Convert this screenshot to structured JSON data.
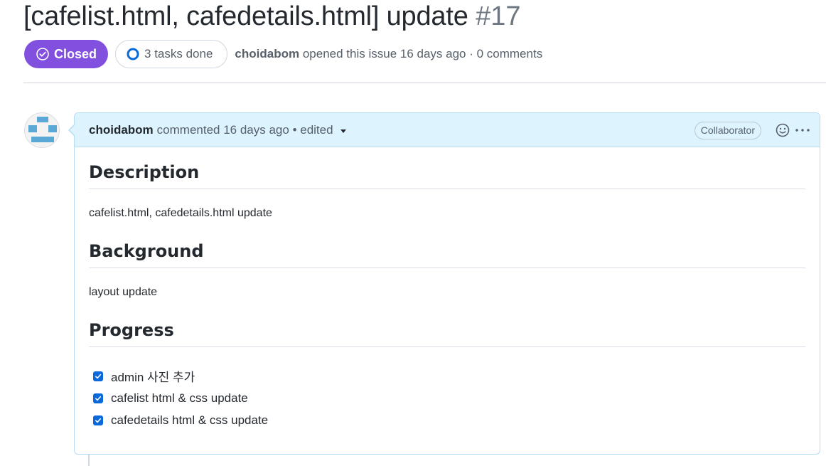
{
  "issue": {
    "title": "[cafelist.html, cafedetails.html] update",
    "number": "#17",
    "state": "Closed",
    "state_color": "#8250df",
    "tasks_summary": "3 tasks done",
    "author": "choidabom",
    "opened_text": "opened this issue 16 days ago · 0 comments"
  },
  "comment": {
    "author": "choidabom",
    "action_text": "commented 16 days ago • edited",
    "role_badge": "Collaborator",
    "header_bg": "#ddf4ff",
    "icons": [
      "smiley-icon",
      "kebab-menu-icon"
    ],
    "sections": [
      {
        "heading": "Description",
        "text": "cafelist.html, cafedetails.html update"
      },
      {
        "heading": "Background",
        "text": "layout update"
      },
      {
        "heading": "Progress",
        "tasks": [
          {
            "label": "admin 사진 추가",
            "checked": true
          },
          {
            "label": "cafelist html & css update",
            "checked": true
          },
          {
            "label": "cafedetails html & css update",
            "checked": true
          }
        ]
      }
    ]
  }
}
